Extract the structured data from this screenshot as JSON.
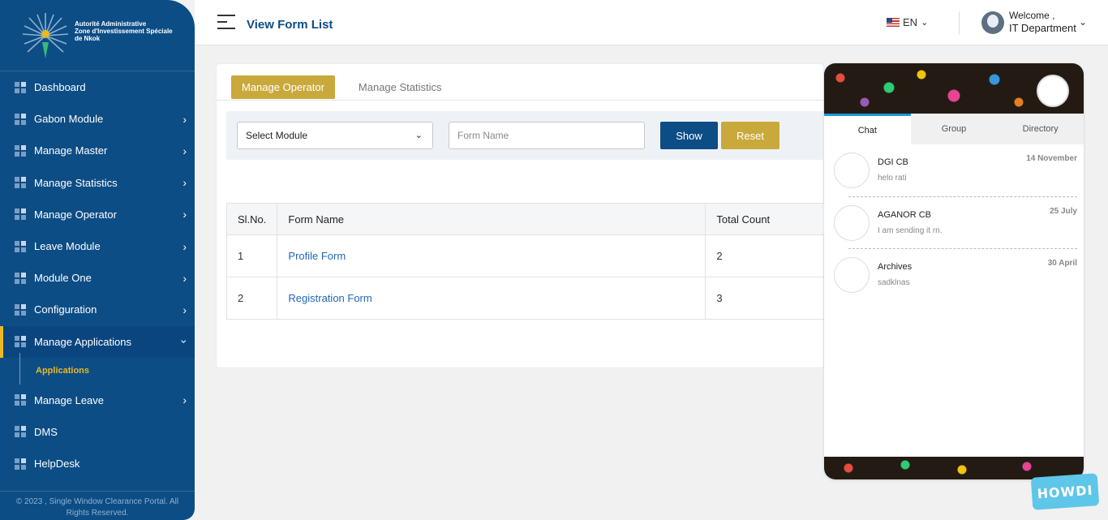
{
  "brand": {
    "line1": "Autorité Administrative",
    "line2": "Zone d'Investissement Spéciale",
    "line3": "de Nkok"
  },
  "sidebar": {
    "items": [
      {
        "label": "Dashboard",
        "has_children": false
      },
      {
        "label": "Gabon Module",
        "has_children": true
      },
      {
        "label": "Manage Master",
        "has_children": true
      },
      {
        "label": "Manage Statistics",
        "has_children": true
      },
      {
        "label": "Manage Operator",
        "has_children": true
      },
      {
        "label": "Leave Module",
        "has_children": true
      },
      {
        "label": "Module One",
        "has_children": true
      },
      {
        "label": "Configuration",
        "has_children": true
      },
      {
        "label": "Manage Applications",
        "has_children": true,
        "expanded": true
      },
      {
        "label": "Manage Leave",
        "has_children": true
      },
      {
        "label": "DMS",
        "has_children": false
      },
      {
        "label": "HelpDesk",
        "has_children": false
      }
    ],
    "sub_item": "Applications",
    "footer_line1": "© 2023 , Single Window Clearance Portal. All",
    "footer_line2": "Rights Reserved."
  },
  "header": {
    "title": "View Form List",
    "language": "EN",
    "welcome": "Welcome ,",
    "user": "IT Department"
  },
  "tabs": [
    "Manage Operator",
    "Manage Statistics"
  ],
  "filter": {
    "module_value": "Select Module",
    "form_placeholder": "Form Name",
    "show_label": "Show",
    "reset_label": "Reset"
  },
  "table": {
    "headers": [
      "Sl.No.",
      "Form Name",
      "Total Count"
    ],
    "rows": [
      {
        "sl": "1",
        "name": "Profile Form",
        "count": "2"
      },
      {
        "sl": "2",
        "name": "Registration Form",
        "count": "3"
      }
    ]
  },
  "chat": {
    "tabs": [
      "Chat",
      "Group",
      "Directory"
    ],
    "conversations": [
      {
        "name": "DGI CB",
        "message": "helo rati",
        "date": "14 November"
      },
      {
        "name": "AGANOR CB",
        "message": "I am sending it rn.",
        "date": "25 July"
      },
      {
        "name": "Archives",
        "message": "sadklnas",
        "date": "30 April"
      }
    ],
    "badge": "HOWDI"
  },
  "colors": {
    "sidebar": "#0d4d85",
    "accent_gold": "#c9a93c",
    "link": "#1f67b5"
  }
}
